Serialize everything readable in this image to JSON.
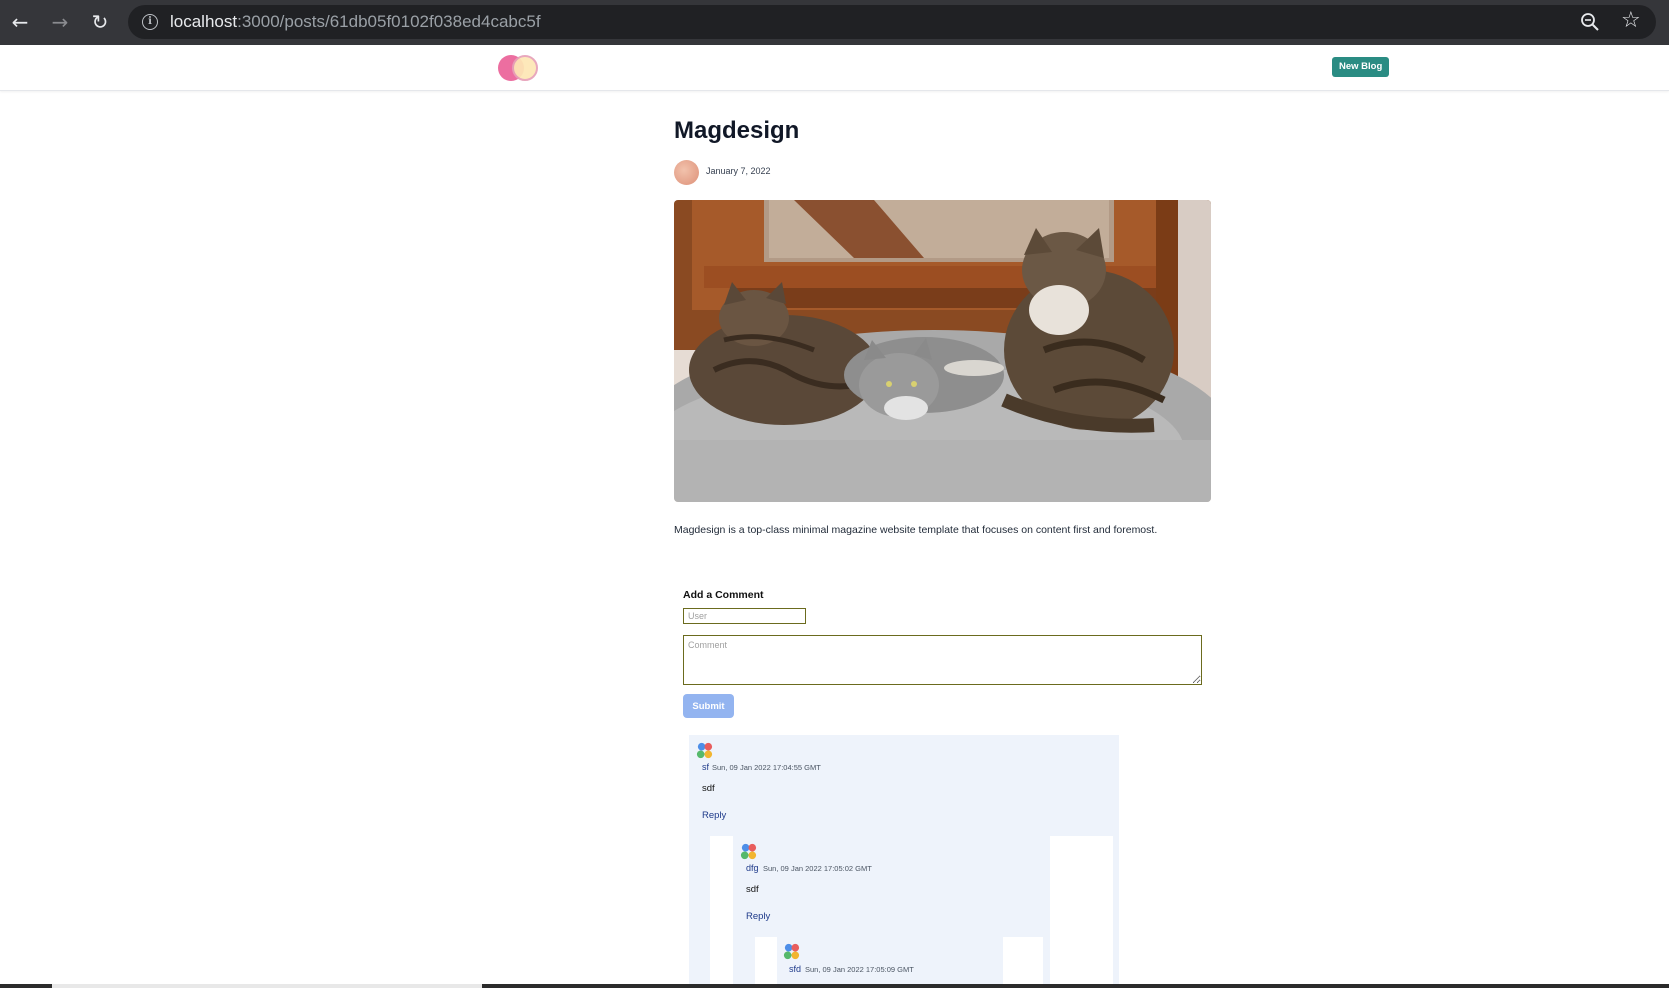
{
  "browser": {
    "url_host": "localhost",
    "url_path": ":3000/posts/61db05f0102f038ed4cabc5f",
    "back_icon": "arrow-left-icon",
    "forward_icon": "arrow-right-icon",
    "reload_icon": "reload-icon",
    "info_icon": "info-icon",
    "zoom_icon": "zoom-out-icon",
    "bookmark_icon": "star-icon"
  },
  "nav": {
    "new_blog_label": "New Blog",
    "accent": "#2a8c83"
  },
  "post": {
    "title": "Magdesign",
    "date": "January 7, 2022",
    "body": "Magdesign is a top-class minimal magazine website template that focuses on content first and foremost."
  },
  "comment_form": {
    "heading": "Add a Comment",
    "user_placeholder": "User",
    "comment_placeholder": "Comment",
    "submit_label": "Submit"
  },
  "comments": [
    {
      "user": "sf",
      "time": "Sun, 09 Jan 2022 17:04:55 GMT",
      "text": "sdf",
      "reply_label": "Reply"
    },
    {
      "user": "dfg",
      "time": "Sun, 09 Jan 2022 17:05:02 GMT",
      "text": "sdf",
      "reply_label": "Reply"
    },
    {
      "user": "sfd",
      "time": "Sun, 09 Jan 2022 17:05:09 GMT"
    }
  ]
}
